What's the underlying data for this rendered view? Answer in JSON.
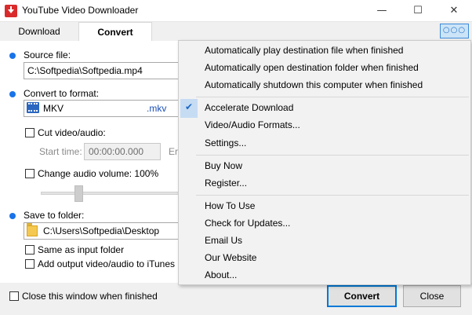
{
  "window": {
    "title": "YouTube Video Downloader",
    "minimize": "—",
    "maximize": "☐",
    "close": "✕"
  },
  "tabs": [
    {
      "label": "Download",
      "active": false
    },
    {
      "label": "Convert",
      "active": true
    }
  ],
  "more_button": "○○○",
  "form": {
    "source_label": "Source file:",
    "source_value": "C:\\Softpedia\\Softpedia.mp4",
    "format_label": "Convert to format:",
    "format_value": "MKV",
    "format_ext": ".mkv",
    "cut_label": "Cut video/audio:",
    "start_time_label": "Start time:",
    "start_time_value": "00:00:00.000",
    "end_label_partial": "Er",
    "audio_volume_label": "Change audio volume: 100%",
    "audio_volume_percent": 100,
    "save_folder_label": "Save to folder:",
    "save_folder_value": "C:\\Users\\Softpedia\\Desktop",
    "same_as_input_label": "Same as input folder",
    "itunes_label": "Add output video/audio to iTunes"
  },
  "footer": {
    "close_when_finished_label": "Close this window when finished",
    "convert_button": "Convert",
    "close_button": "Close"
  },
  "menu": {
    "groups": [
      [
        "Automatically play destination file when finished",
        "Automatically open destination folder when finished",
        "Automatically shutdown this computer when finished"
      ],
      [
        "Accelerate Download",
        "Video/Audio Formats...",
        "Settings..."
      ],
      [
        "Buy Now",
        "Register..."
      ],
      [
        "How To Use",
        "Check for Updates...",
        "Email Us",
        "Our Website",
        "About..."
      ]
    ],
    "checked_item": "Accelerate Download",
    "check_glyph": "✔"
  },
  "colors": {
    "accent": "#1a73e8",
    "selection": "#cce4f7",
    "primary_button_border": "#0078d7"
  }
}
